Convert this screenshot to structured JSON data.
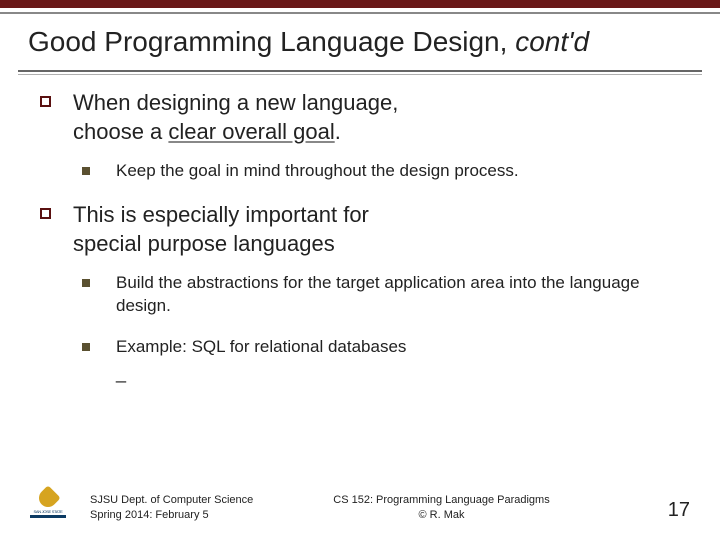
{
  "header": {
    "title_main": "Good Programming Language Design, ",
    "title_italic": "cont'd"
  },
  "bullets": {
    "b1": {
      "line1": "When designing a new language,",
      "line2a": "choose a ",
      "line2b": "clear overall goal",
      "line2c": "."
    },
    "b1_sub1": "Keep the goal in mind throughout the design process.",
    "b2": {
      "line1": "This is especially important for",
      "line2": "special purpose languages"
    },
    "b2_sub1": "Build the abstractions for the target application area into the language design.",
    "b2_sub2": "Example: SQL for relational databases",
    "dash": "_"
  },
  "footer": {
    "left_line1": "SJSU Dept. of Computer Science",
    "left_line2": "Spring 2014: February 5",
    "center_line1": "CS 152: Programming Language Paradigms",
    "center_line2": "© R. Mak",
    "page": "17",
    "logo_text": "SAN JOSE STATE"
  }
}
